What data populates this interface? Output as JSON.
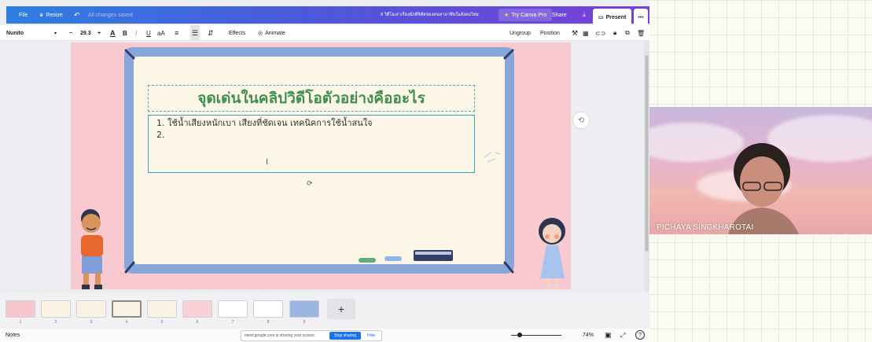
{
  "canva": {
    "topbar": {
      "file": "File",
      "resize": "Resize",
      "undo_icon": "undo-icon",
      "save_status": "All changes saved",
      "doc_title": "8 วิดีโอเล่าเรื่องนักดิจิทัลของคนหาอาชีพในสังคมไทย",
      "try_pro": "Try Canva Pro",
      "share": "Share",
      "present": "Present",
      "more": "•••"
    },
    "toolbar": {
      "font": "Nunito",
      "font_size": "29.3",
      "minus": "−",
      "plus": "+",
      "color_letter": "A",
      "bold": "B",
      "italic": "I",
      "underline": "U",
      "case": "aA",
      "effects": "Effects",
      "animate": "Animate",
      "ungroup": "Ungroup",
      "position": "Position"
    },
    "slide": {
      "title": "จุดเด่นในคลิปวิดีโอตัวอย่างคืออะไร",
      "lines": [
        "1. ใช้น้ำเสียงหนักเบา เสียงที่ชัดเจน เทคนิคการใช้น้ำสนใจ",
        "2."
      ]
    },
    "thumbnails": {
      "pages": [
        "1",
        "2",
        "3",
        "4",
        "5",
        "6",
        "7",
        "8",
        "9"
      ],
      "active_page": "4",
      "add": "+"
    },
    "status": {
      "notes": "Notes",
      "zoom": "74%",
      "help": "?"
    },
    "share_banner": {
      "text": "meet.google.com is sharing your screen.",
      "stop": "Stop sharing",
      "hide": "Hide"
    }
  },
  "video": {
    "participant_name": "PICHAYA SINGKHAROTAI"
  },
  "colors": {
    "accent_gradient_start": "#2e7fe0",
    "accent_gradient_end": "#7a3fd6",
    "slide_background": "#f9c9d0",
    "title_green": "#3f8f4f",
    "board_frame": "#89a6da",
    "selection": "#3aa2c4"
  }
}
